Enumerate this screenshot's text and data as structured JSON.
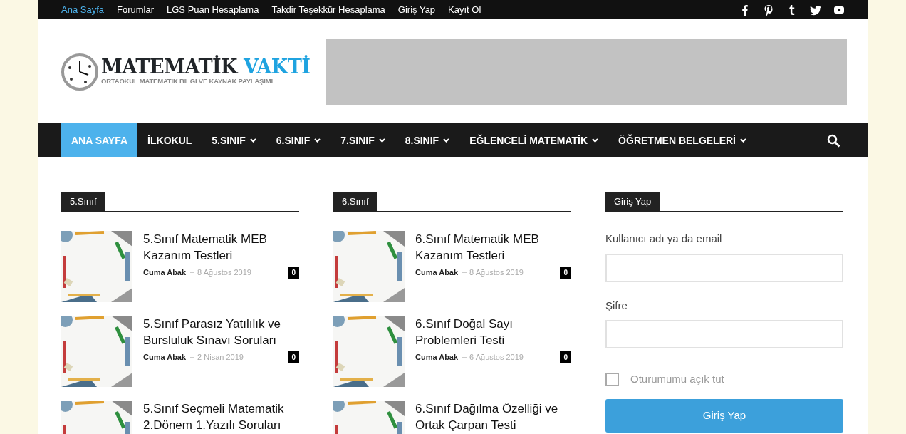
{
  "top_menu": [
    {
      "label": "Ana Sayfa",
      "selected": true
    },
    {
      "label": "Forumlar",
      "selected": false
    },
    {
      "label": "LGS Puan Hesaplama",
      "selected": false
    },
    {
      "label": "Takdir Teşekkür Hesaplama",
      "selected": false
    },
    {
      "label": "Giriş Yap",
      "selected": false
    },
    {
      "label": "Kayıt Ol",
      "selected": false
    }
  ],
  "social": [
    {
      "kind": "facebook"
    },
    {
      "kind": "pinterest"
    },
    {
      "kind": "tumblr"
    },
    {
      "kind": "twitter"
    },
    {
      "kind": "youtube"
    }
  ],
  "logo": {
    "title_main": "MATEMATİK",
    "title_accent": "VAKTİ",
    "subtitle": "ORTAOKUL MATEMATİK BİLGİ VE KAYNAK PAYLAŞIMI"
  },
  "main_nav": [
    {
      "label": "ANA SAYFA",
      "selected": true,
      "dropdown": false
    },
    {
      "label": "İLKOKUL",
      "selected": false,
      "dropdown": false
    },
    {
      "label": "5.SINIF",
      "selected": false,
      "dropdown": true
    },
    {
      "label": "6.SINIF",
      "selected": false,
      "dropdown": true
    },
    {
      "label": "7.SINIF",
      "selected": false,
      "dropdown": true
    },
    {
      "label": "8.SINIF",
      "selected": false,
      "dropdown": true
    },
    {
      "label": "EĞLENCELİ MATEMATİK",
      "selected": false,
      "dropdown": true
    },
    {
      "label": "ÖĞRETMEN BELGELERİ",
      "selected": false,
      "dropdown": true
    }
  ],
  "sections": [
    {
      "title": "5.Sınıf",
      "posts": [
        {
          "title": "5.Sınıf Matematik MEB Kazanım Testleri",
          "author": "Cuma Abak",
          "date": "8 Ağustos 2019",
          "comments": "0"
        },
        {
          "title": "5.Sınıf Parasız Yatılılık ve Bursluluk Sınavı Soruları",
          "author": "Cuma Abak",
          "date": "2 Nisan 2019",
          "comments": "0"
        },
        {
          "title": "5.Sınıf Seçmeli Matematik 2.Dönem 1.Yazılı Soruları"
        }
      ]
    },
    {
      "title": "6.Sınıf",
      "posts": [
        {
          "title": "6.Sınıf Matematik MEB Kazanım Testleri",
          "author": "Cuma Abak",
          "date": "8 Ağustos 2019",
          "comments": "0"
        },
        {
          "title": "6.Sınıf Doğal Sayı Problemleri Testi",
          "author": "Cuma Abak",
          "date": "6 Ağustos 2019",
          "comments": "0"
        },
        {
          "title": "6.Sınıf Dağılma Özelliği ve Ortak Çarpan Testi"
        }
      ]
    }
  ],
  "login": {
    "title": "Giriş Yap",
    "username_label": "Kullanıcı adı ya da email",
    "password_label": "Şifre",
    "remember": {
      "label": "Oturumumu açık tut",
      "checked": false
    },
    "button": "Giriş Yap"
  }
}
